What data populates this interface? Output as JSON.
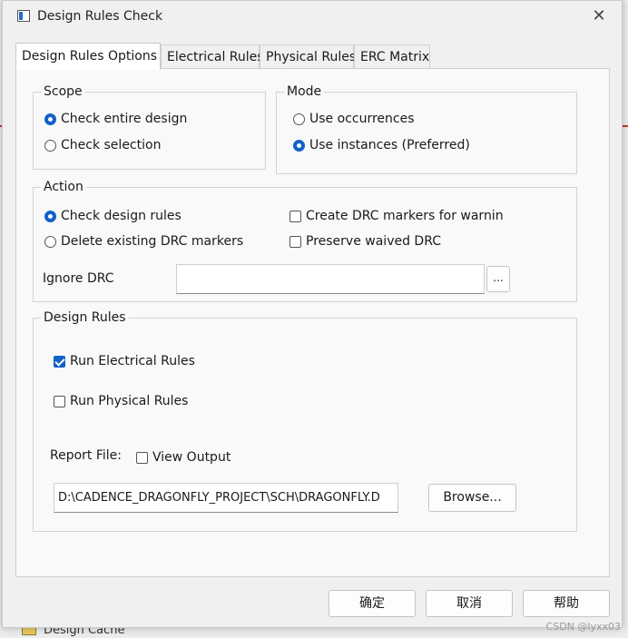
{
  "dialog": {
    "title": "Design Rules Check",
    "close_glyph": "✕"
  },
  "tabs": [
    {
      "label": "Design Rules Options",
      "active": true
    },
    {
      "label": "Electrical Rules",
      "active": false
    },
    {
      "label": "Physical Rules",
      "active": false
    },
    {
      "label": "ERC Matrix",
      "active": false
    }
  ],
  "scope": {
    "title": "Scope",
    "options": [
      {
        "label": "Check entire design",
        "selected": true
      },
      {
        "label": "Check selection",
        "selected": false
      }
    ]
  },
  "mode": {
    "title": "Mode",
    "options": [
      {
        "label": "Use occurrences",
        "selected": false
      },
      {
        "label": "Use instances (Preferred)",
        "selected": true
      }
    ]
  },
  "action": {
    "title": "Action",
    "radios": [
      {
        "label": "Check design rules",
        "selected": true
      },
      {
        "label": "Delete existing DRC markers",
        "selected": false
      }
    ],
    "checks": [
      {
        "label": "Create DRC markers for warnings",
        "checked": false
      },
      {
        "label": "Preserve waived DRC",
        "checked": false
      }
    ],
    "ignore_label": "Ignore DRC",
    "ignore_value": "",
    "ellipsis": "..."
  },
  "design_rules": {
    "title": "Design Rules",
    "run_electrical": {
      "label": "Run Electrical Rules",
      "checked": true
    },
    "run_physical": {
      "label": "Run Physical Rules",
      "checked": false
    },
    "report_label": "Report File:",
    "view_output": {
      "label": "View Output",
      "checked": false
    },
    "report_path": "D:\\CADENCE_DRAGONFLY_PROJECT\\SCH\\DRAGONFLY.D",
    "browse_label": "Browse..."
  },
  "footer": {
    "ok_label": "确定",
    "cancel_label": "取消",
    "help_label": "帮助"
  },
  "background": {
    "bottom_item": "Design Cache"
  },
  "watermark": "CSDN @lyxx03"
}
